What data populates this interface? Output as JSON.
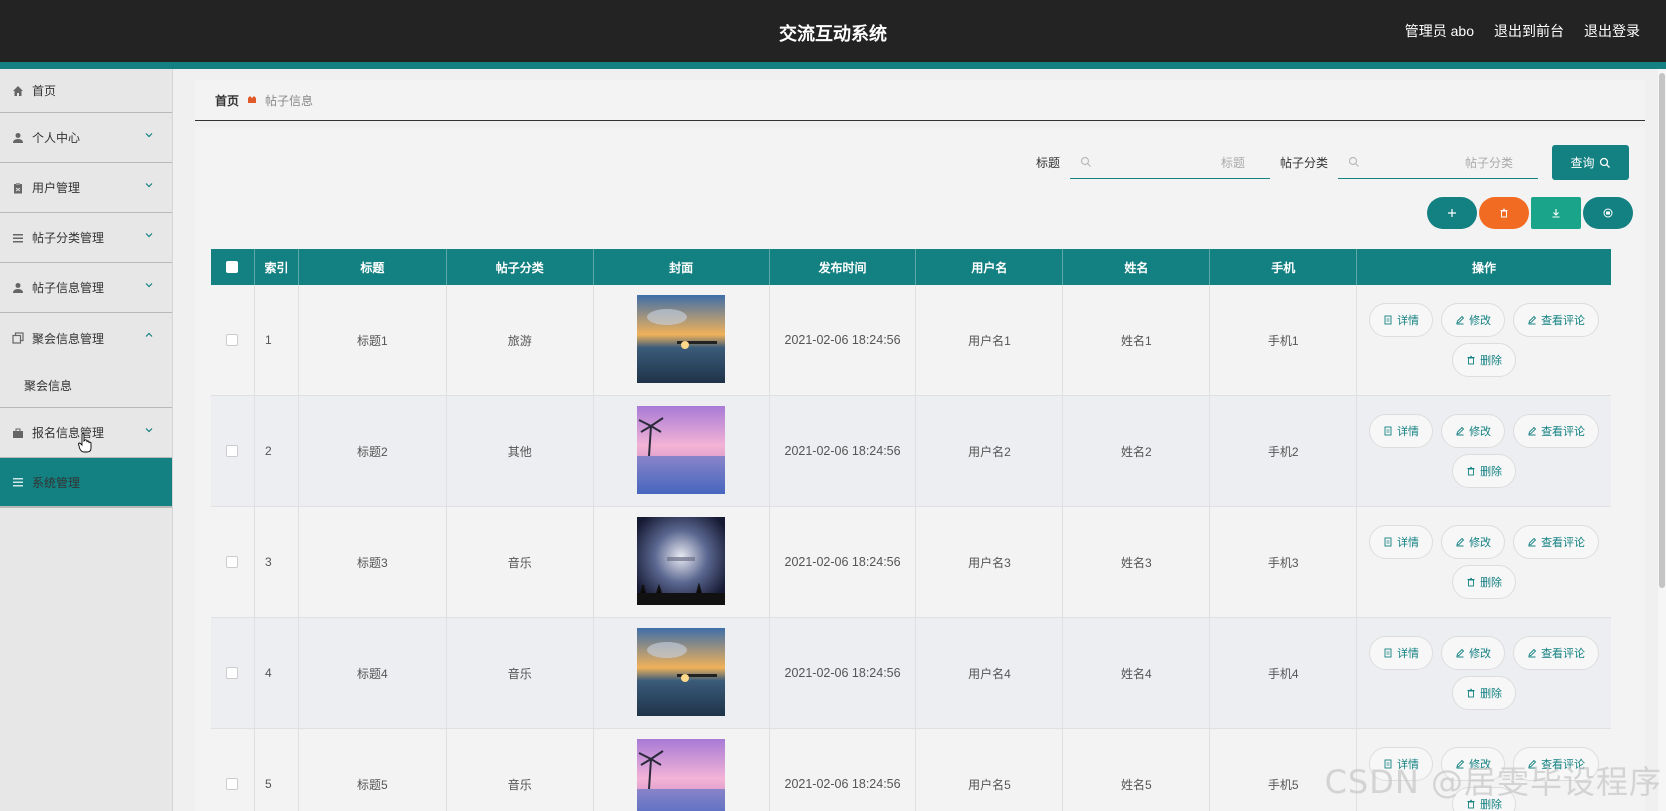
{
  "header": {
    "title": "交流互动系统",
    "admin": "管理员 abo",
    "exit_front": "退出到前台",
    "logout": "退出登录"
  },
  "sidebar": {
    "items": [
      {
        "label": "首页",
        "icon": "home-icon"
      },
      {
        "label": "个人中心",
        "icon": "user-icon"
      },
      {
        "label": "用户管理",
        "icon": "clipboard-icon"
      },
      {
        "label": "帖子分类管理",
        "icon": "list-icon"
      },
      {
        "label": "帖子信息管理",
        "icon": "user-icon"
      },
      {
        "label": "聚会信息管理",
        "icon": "copy-icon"
      },
      {
        "label": "报名信息管理",
        "icon": "briefcase-icon"
      },
      {
        "label": "系统管理",
        "icon": "list-icon"
      }
    ],
    "sub_item": "聚会信息"
  },
  "breadcrumb": {
    "home": "首页",
    "current": "帖子信息"
  },
  "search": {
    "title_label": "标题",
    "title_placeholder": "标题",
    "category_label": "帖子分类",
    "category_placeholder": "帖子分类",
    "query_label": "查询"
  },
  "actions": {
    "add_color": "#138082",
    "delete_color": "#f26b22",
    "download_color": "#1aa58a",
    "print_color": "#138082"
  },
  "table": {
    "columns": [
      "索引",
      "标题",
      "帖子分类",
      "封面",
      "发布时间",
      "用户名",
      "姓名",
      "手机",
      "操作"
    ],
    "rows": [
      {
        "index": "1",
        "title": "标题1",
        "category": "旅游",
        "time": "2021-02-06 18:24:56",
        "username": "用户名1",
        "name": "姓名1",
        "phone": "手机1",
        "cover": "sunset-pier"
      },
      {
        "index": "2",
        "title": "标题2",
        "category": "其他",
        "time": "2021-02-06 18:24:56",
        "username": "用户名2",
        "name": "姓名2",
        "phone": "手机2",
        "cover": "pink-palm"
      },
      {
        "index": "3",
        "title": "标题3",
        "category": "音乐",
        "time": "2021-02-06 18:24:56",
        "username": "用户名3",
        "name": "姓名3",
        "phone": "手机3",
        "cover": "night-concert"
      },
      {
        "index": "4",
        "title": "标题4",
        "category": "音乐",
        "time": "2021-02-06 18:24:56",
        "username": "用户名4",
        "name": "姓名4",
        "phone": "手机4",
        "cover": "sunset-pier"
      },
      {
        "index": "5",
        "title": "标题5",
        "category": "音乐",
        "time": "2021-02-06 18:24:56",
        "username": "用户名5",
        "name": "姓名5",
        "phone": "手机5",
        "cover": "pink-palm"
      }
    ],
    "ops": {
      "detail": "详情",
      "edit": "修改",
      "comments": "查看评论",
      "delete": "删除"
    }
  },
  "watermark": "CSDN @居雯毕设程序"
}
